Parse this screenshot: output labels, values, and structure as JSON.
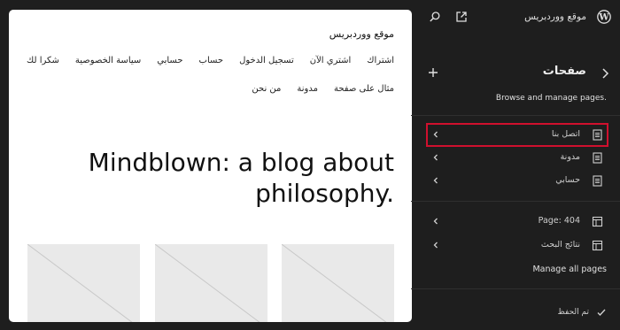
{
  "colors": {
    "background": "#1e1e1e",
    "sidebar_text": "#e0e0e0",
    "highlight_border": "#d0102e",
    "preview_bg": "#ffffff",
    "placeholder_bg": "#e9e9e9"
  },
  "sidebar": {
    "site_name": "موقع ووردبريس",
    "title": "صفحات",
    "description": "Browse and manage pages.",
    "pages": [
      {
        "label": "اتصل بنا",
        "icon": "page-icon",
        "active": true
      },
      {
        "label": "مدونة",
        "icon": "page-icon",
        "active": false
      },
      {
        "label": "حسابي",
        "icon": "page-icon",
        "active": false
      }
    ],
    "templates": [
      {
        "label": "Page: 404",
        "icon": "template-icon"
      },
      {
        "label": "نتائج البحث",
        "icon": "template-icon"
      }
    ],
    "manage_all": "Manage all pages",
    "saved": "تم الحفظ",
    "icons": {
      "logo": "wordpress-logo-icon",
      "back": "chevron-right-icon",
      "add": "plus-icon",
      "external": "external-link-icon",
      "search": "search-icon",
      "item_chevron": "chevron-left-icon",
      "check": "check-icon"
    }
  },
  "preview": {
    "site_title": "موقع ووردبريس",
    "menu_row1": [
      "اشتراك",
      "اشتري الآن",
      "تسجيل الدخول",
      "حساب",
      "حسابي",
      "سياسة الخصوصية",
      "شكرا لك"
    ],
    "menu_row2": [
      "مثال على صفحة",
      "مدونة",
      "من نحن"
    ],
    "hero_line1": "Mindblown: a blog about",
    "hero_line2": "philosophy."
  }
}
